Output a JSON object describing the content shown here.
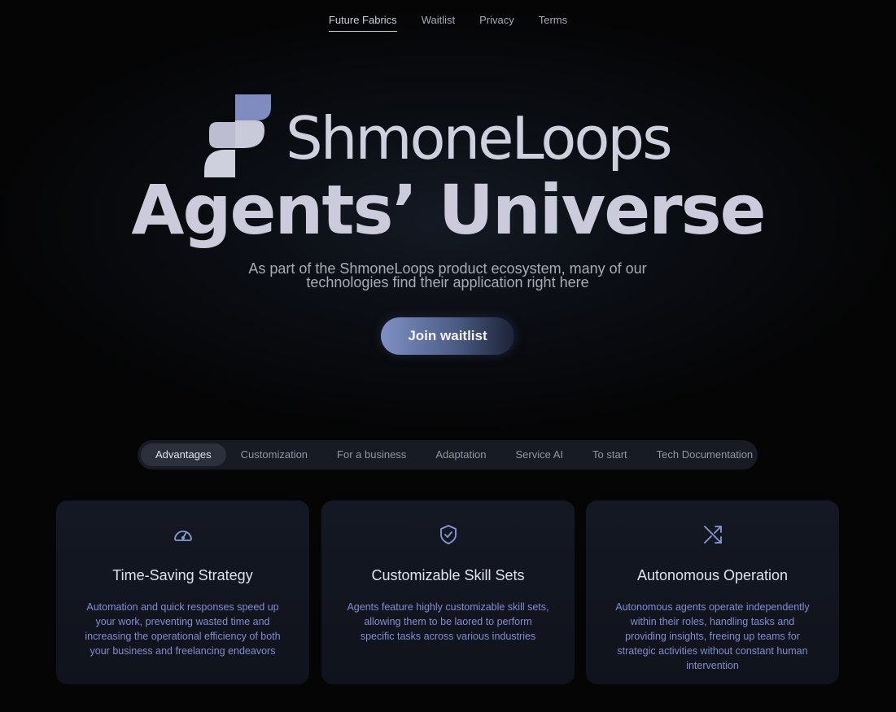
{
  "nav": {
    "items": [
      {
        "label": "Future Fabrics",
        "active": true
      },
      {
        "label": "Waitlist"
      },
      {
        "label": "Privacy"
      },
      {
        "label": "Terms"
      }
    ]
  },
  "brand": {
    "name": "ShmoneLoops",
    "icon": "brand-logo-mark"
  },
  "hero": {
    "title": "Agents’ Universe",
    "subtitle": "As part of the ShmoneLoops product ecosystem, many of our technologies find their application right here",
    "cta_label": "Join waitlist"
  },
  "tabs": [
    {
      "label": "Advantages",
      "active": true
    },
    {
      "label": "Customization"
    },
    {
      "label": "For a business"
    },
    {
      "label": "Adaptation"
    },
    {
      "label": "Service AI"
    },
    {
      "label": "To start"
    },
    {
      "label": "Tech Documentation"
    }
  ],
  "cards": [
    {
      "icon": "speedometer-icon",
      "title": "Time-Saving Strategy",
      "text": "Automation and quick responses speed up your work, preventing wasted time and increasing the operational efficiency of both your business and freelancing endeavors"
    },
    {
      "icon": "shield-check-icon",
      "title": "Customizable Skill Sets",
      "text": "Agents feature highly customizable skill sets, allowing them to be laored to perform specific tasks across various industries"
    },
    {
      "icon": "shuffle-icon",
      "title": "Autonomous Operation",
      "text": "Autonomous agents operate independently within their roles, handling tasks and providing insights, freeing up teams for strategic activities without constant human intervention"
    }
  ],
  "colors": {
    "accent": "#7f91c4",
    "card_text": "#7f8fd0",
    "background": "#050506"
  }
}
